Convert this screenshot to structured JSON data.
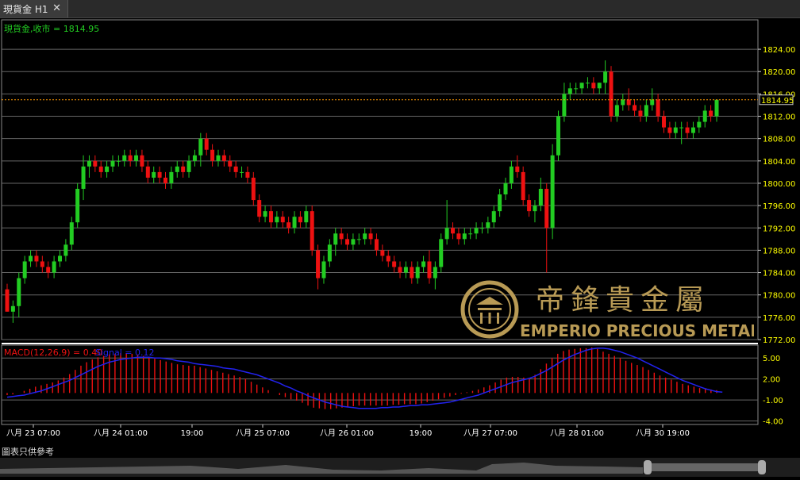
{
  "tab": {
    "title": "現貨金 H1"
  },
  "price_pane": {
    "legend": "現貨金,收市 = 1814.95",
    "current_price_label": "1814.95"
  },
  "macd_pane": {
    "legend_main": "MACD(12,26,9) = 0.40",
    "legend_signal": "Signal = 0.12"
  },
  "x_axis_labels": [
    "八月 23 07:00",
    "八月 24 01:00",
    "19:00",
    "八月 25 07:00",
    "八月 26 01:00",
    "19:00",
    "八月 27 07:00",
    "八月 28 01:00",
    "八月 30 19:00"
  ],
  "footnote": "圖表只供參考",
  "watermark": {
    "chinese": "帝鋒貴金屬",
    "english": "EMPERIO PRECIOUS METALS"
  },
  "colors": {
    "up": "#22cc22",
    "down": "#ee1111",
    "signal": "#2222ee",
    "axis_text": "#ffff00",
    "current_line": "#ff9900",
    "watermark": "#b89a55"
  },
  "chart_data": [
    {
      "type": "candlestick",
      "ylim": [
        1772,
        1826
      ],
      "yticks": [
        "1824.00",
        "1820.00",
        "1816.00",
        "1812.00",
        "1808.00",
        "1804.00",
        "1800.00",
        "1796.00",
        "1792.00",
        "1788.00",
        "1784.00",
        "1780.00",
        "1776.00",
        "1772.00"
      ],
      "current_price": 1814.95,
      "ohlc": [
        [
          1781,
          1782,
          1777,
          1777
        ],
        [
          1777,
          1779,
          1775,
          1778
        ],
        [
          1778,
          1784,
          1776,
          1783
        ],
        [
          1783,
          1787,
          1782,
          1786
        ],
        [
          1786,
          1788,
          1785,
          1787
        ],
        [
          1787,
          1788,
          1785,
          1786
        ],
        [
          1786,
          1787,
          1784,
          1785
        ],
        [
          1785,
          1786,
          1783,
          1784
        ],
        [
          1784,
          1787,
          1783,
          1786
        ],
        [
          1786,
          1788,
          1785,
          1787
        ],
        [
          1787,
          1790,
          1786,
          1789
        ],
        [
          1789,
          1794,
          1788,
          1793
        ],
        [
          1793,
          1800,
          1792,
          1799
        ],
        [
          1799,
          1805,
          1797,
          1803
        ],
        [
          1803,
          1805,
          1801,
          1804
        ],
        [
          1804,
          1805,
          1802,
          1803
        ],
        [
          1803,
          1804,
          1801,
          1802
        ],
        [
          1802,
          1804,
          1801,
          1803
        ],
        [
          1803,
          1805,
          1802,
          1804
        ],
        [
          1804,
          1805,
          1803,
          1804
        ],
        [
          1804,
          1806,
          1803,
          1805
        ],
        [
          1805,
          1806,
          1803,
          1804
        ],
        [
          1804,
          1806,
          1803,
          1805
        ],
        [
          1805,
          1806,
          1802,
          1803
        ],
        [
          1803,
          1804,
          1800,
          1801
        ],
        [
          1801,
          1803,
          1800,
          1802
        ],
        [
          1802,
          1803,
          1800,
          1801
        ],
        [
          1801,
          1802,
          1799,
          1800
        ],
        [
          1800,
          1803,
          1799,
          1802
        ],
        [
          1802,
          1804,
          1801,
          1803
        ],
        [
          1803,
          1804,
          1801,
          1802
        ],
        [
          1802,
          1805,
          1801,
          1804
        ],
        [
          1804,
          1806,
          1803,
          1805
        ],
        [
          1805,
          1809,
          1803,
          1808
        ],
        [
          1808,
          1809,
          1805,
          1806
        ],
        [
          1806,
          1807,
          1803,
          1804
        ],
        [
          1804,
          1806,
          1803,
          1805
        ],
        [
          1805,
          1806,
          1803,
          1804
        ],
        [
          1804,
          1805,
          1802,
          1803
        ],
        [
          1803,
          1804,
          1801,
          1802
        ],
        [
          1802,
          1803,
          1801,
          1802
        ],
        [
          1802,
          1803,
          1800,
          1801
        ],
        [
          1801,
          1802,
          1796,
          1797
        ],
        [
          1797,
          1798,
          1793,
          1794
        ],
        [
          1794,
          1796,
          1793,
          1795
        ],
        [
          1795,
          1796,
          1792,
          1793
        ],
        [
          1793,
          1795,
          1792,
          1794
        ],
        [
          1794,
          1795,
          1792,
          1793
        ],
        [
          1793,
          1794,
          1791,
          1792
        ],
        [
          1792,
          1795,
          1791,
          1794
        ],
        [
          1794,
          1795,
          1792,
          1793
        ],
        [
          1793,
          1796,
          1792,
          1795
        ],
        [
          1795,
          1796,
          1787,
          1788
        ],
        [
          1788,
          1789,
          1781,
          1783
        ],
        [
          1783,
          1787,
          1782,
          1786
        ],
        [
          1786,
          1790,
          1785,
          1789
        ],
        [
          1789,
          1792,
          1787,
          1791
        ],
        [
          1791,
          1792,
          1789,
          1790
        ],
        [
          1790,
          1791,
          1788,
          1789
        ],
        [
          1789,
          1791,
          1788,
          1790
        ],
        [
          1790,
          1791,
          1789,
          1790
        ],
        [
          1790,
          1792,
          1789,
          1791
        ],
        [
          1791,
          1792,
          1789,
          1790
        ],
        [
          1790,
          1791,
          1787,
          1788
        ],
        [
          1788,
          1789,
          1786,
          1787
        ],
        [
          1787,
          1788,
          1785,
          1786
        ],
        [
          1786,
          1787,
          1784,
          1785
        ],
        [
          1785,
          1786,
          1783,
          1784
        ],
        [
          1784,
          1786,
          1783,
          1785
        ],
        [
          1785,
          1786,
          1782,
          1783
        ],
        [
          1783,
          1786,
          1782,
          1785
        ],
        [
          1785,
          1787,
          1784,
          1786
        ],
        [
          1786,
          1788,
          1782,
          1783
        ],
        [
          1783,
          1786,
          1781,
          1785
        ],
        [
          1785,
          1791,
          1784,
          1790
        ],
        [
          1790,
          1797,
          1789,
          1792
        ],
        [
          1792,
          1793,
          1790,
          1791
        ],
        [
          1791,
          1792,
          1789,
          1790
        ],
        [
          1790,
          1792,
          1789,
          1791
        ],
        [
          1791,
          1792,
          1790,
          1791
        ],
        [
          1791,
          1793,
          1790,
          1792
        ],
        [
          1792,
          1793,
          1791,
          1792
        ],
        [
          1792,
          1794,
          1791,
          1793
        ],
        [
          1793,
          1796,
          1792,
          1795
        ],
        [
          1795,
          1799,
          1794,
          1798
        ],
        [
          1798,
          1801,
          1797,
          1800
        ],
        [
          1800,
          1804,
          1799,
          1803
        ],
        [
          1803,
          1805,
          1801,
          1802
        ],
        [
          1802,
          1803,
          1796,
          1797
        ],
        [
          1797,
          1798,
          1794,
          1795
        ],
        [
          1795,
          1797,
          1793,
          1796
        ],
        [
          1796,
          1801,
          1795,
          1799
        ],
        [
          1799,
          1800,
          1784,
          1792
        ],
        [
          1792,
          1807,
          1790,
          1805
        ],
        [
          1805,
          1813,
          1804,
          1812
        ],
        [
          1812,
          1818,
          1811,
          1816
        ],
        [
          1816,
          1818,
          1815,
          1817
        ],
        [
          1817,
          1818,
          1816,
          1817
        ],
        [
          1817,
          1818,
          1816,
          1818
        ],
        [
          1818,
          1819,
          1817,
          1818
        ],
        [
          1818,
          1819,
          1816,
          1817
        ],
        [
          1817,
          1818,
          1816,
          1818
        ],
        [
          1818,
          1822,
          1816,
          1820
        ],
        [
          1820,
          1821,
          1811,
          1812
        ],
        [
          1812,
          1815,
          1811,
          1814
        ],
        [
          1814,
          1816,
          1813,
          1815
        ],
        [
          1815,
          1817,
          1813,
          1814
        ],
        [
          1814,
          1815,
          1812,
          1813
        ],
        [
          1813,
          1814,
          1811,
          1812
        ],
        [
          1812,
          1815,
          1811,
          1814
        ],
        [
          1814,
          1817,
          1813,
          1815
        ],
        [
          1815,
          1816,
          1811,
          1812
        ],
        [
          1812,
          1813,
          1809,
          1810
        ],
        [
          1810,
          1811,
          1808,
          1809
        ],
        [
          1809,
          1811,
          1808,
          1810
        ],
        [
          1810,
          1811,
          1807,
          1810
        ],
        [
          1810,
          1811,
          1808,
          1809
        ],
        [
          1809,
          1811,
          1808,
          1810
        ],
        [
          1810,
          1812,
          1809,
          1811
        ],
        [
          1811,
          1814,
          1810,
          1813
        ],
        [
          1813,
          1814,
          1811,
          1812
        ],
        [
          1812,
          1815,
          1811,
          1814.95
        ]
      ]
    },
    {
      "type": "histogram+line",
      "ylim": [
        -4.5,
        6.5
      ],
      "yticks": [
        "5.00",
        "2.00",
        "-1.00",
        "-4.00"
      ],
      "macd": [
        -0.3,
        -0.2,
        0,
        0.3,
        0.6,
        0.9,
        1.1,
        1.3,
        1.5,
        1.8,
        2.2,
        2.7,
        3.3,
        3.9,
        4.4,
        4.8,
        5.1,
        5.3,
        5.5,
        5.6,
        5.7,
        5.7,
        5.6,
        5.5,
        5.3,
        5.1,
        4.9,
        4.7,
        4.5,
        4.3,
        4.1,
        4,
        3.9,
        3.9,
        3.7,
        3.5,
        3.3,
        3.1,
        2.9,
        2.7,
        2.5,
        2.3,
        2,
        1.6,
        1.2,
        0.8,
        0.4,
        0,
        -0.3,
        -0.6,
        -0.9,
        -1.1,
        -1.4,
        -1.8,
        -2.1,
        -2.2,
        -2.3,
        -2.3,
        -2.2,
        -2.1,
        -2,
        -1.9,
        -1.8,
        -1.8,
        -1.8,
        -1.8,
        -1.8,
        -1.8,
        -1.7,
        -1.7,
        -1.6,
        -1.6,
        -1.6,
        -1.5,
        -1.3,
        -1.1,
        -0.9,
        -0.7,
        -0.5,
        -0.3,
        -0.1,
        0.1,
        0.3,
        0.5,
        0.8,
        1.1,
        1.5,
        1.9,
        2.2,
        2.3,
        2.3,
        2.2,
        2.1,
        2.6,
        3.4,
        4.2,
        5,
        5.6,
        6,
        6.2,
        6.3,
        6.4,
        6.4,
        6.5,
        6.3,
        5.9,
        5.6,
        5.3,
        5,
        4.6,
        4.3,
        4,
        3.7,
        3.3,
        2.9,
        2.5,
        2.2,
        1.9,
        1.6,
        1.3,
        1.1,
        0.9,
        0.7,
        0.6,
        0.5,
        0.4
      ],
      "signal": [
        -0.6,
        -0.5,
        -0.4,
        -0.3,
        -0.1,
        0.1,
        0.3,
        0.6,
        0.9,
        1.2,
        1.5,
        1.8,
        2.2,
        2.6,
        3,
        3.4,
        3.8,
        4.1,
        4.4,
        4.6,
        4.8,
        4.9,
        5,
        5.1,
        5.1,
        5.1,
        5,
        5,
        4.9,
        4.8,
        4.6,
        4.5,
        4.4,
        4.2,
        4.1,
        4,
        3.9,
        3.8,
        3.6,
        3.5,
        3.4,
        3.2,
        3,
        2.8,
        2.6,
        2.3,
        2,
        1.7,
        1.4,
        1,
        0.7,
        0.3,
        0,
        -0.4,
        -0.7,
        -1,
        -1.3,
        -1.5,
        -1.7,
        -1.9,
        -2,
        -2.1,
        -2.2,
        -2.2,
        -2.2,
        -2.2,
        -2.1,
        -2.1,
        -2,
        -2,
        -1.9,
        -1.8,
        -1.8,
        -1.7,
        -1.7,
        -1.6,
        -1.5,
        -1.4,
        -1.3,
        -1.1,
        -0.9,
        -0.7,
        -0.5,
        -0.3,
        0,
        0.3,
        0.6,
        0.9,
        1.2,
        1.5,
        1.7,
        1.9,
        2.1,
        2.4,
        2.8,
        3.2,
        3.7,
        4.2,
        4.7,
        5.1,
        5.5,
        5.8,
        6.1,
        6.3,
        6.4,
        6.4,
        6.3,
        6.1,
        5.9,
        5.6,
        5.3,
        5,
        4.6,
        4.2,
        3.8,
        3.4,
        3,
        2.6,
        2.2,
        1.8,
        1.5,
        1.2,
        0.9,
        0.6,
        0.4,
        0.2,
        0.12
      ]
    }
  ]
}
